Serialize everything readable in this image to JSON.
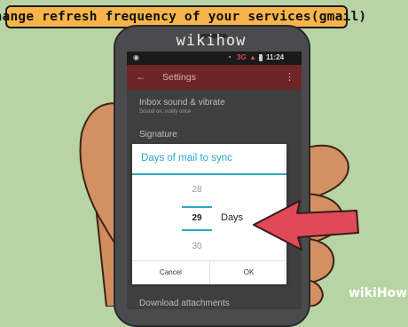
{
  "banner": {
    "text": "Change refresh frequency of your services(gmail)"
  },
  "watermark": {
    "phone_text": "wikihow",
    "corner_text_a": "wiki",
    "corner_text_b": "How"
  },
  "statusbar": {
    "network": "3G",
    "time": "11:24"
  },
  "appbar": {
    "title": "Settings",
    "back_glyph": "←",
    "more_glyph": "⋮"
  },
  "settings": {
    "inbox_sound": "Inbox sound & vibrate",
    "inbox_sound_sub": "Sound on, notify once",
    "signature": "Signature",
    "download_attachments": "Download attachments"
  },
  "dialog": {
    "title": "Days of mail to sync",
    "picker": {
      "prev": "28",
      "selected": "29",
      "next": "30"
    },
    "unit": "Days",
    "cancel_label": "Cancel",
    "ok_label": "OK"
  },
  "colors": {
    "background": "#b8d4a4",
    "banner": "#f6b54a",
    "accent": "#2ba8c6",
    "appbar": "#6e2525",
    "arrow": "#e04a58",
    "hand": "#d18c5e"
  },
  "icons": [
    "back-arrow-icon",
    "overflow-menu-icon",
    "wifi-icon",
    "signal-icon",
    "battery-icon",
    "pointer-arrow-icon"
  ]
}
